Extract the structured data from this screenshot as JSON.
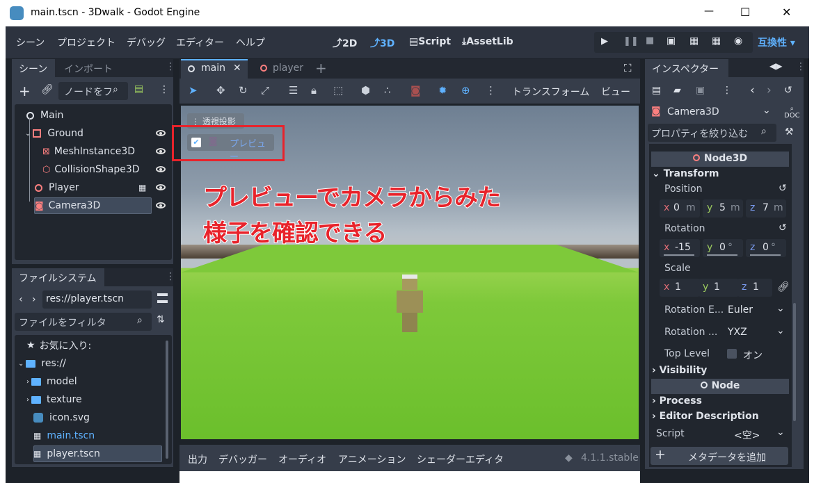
{
  "window": {
    "title": "main.tscn - 3Dwalk - Godot Engine",
    "minimize": "—",
    "maximize": "☐",
    "close": "✕"
  },
  "menu": {
    "items": [
      "シーン",
      "プロジェクト",
      "デバッグ",
      "エディター",
      "ヘルプ"
    ],
    "workspaces": [
      "2D",
      "3D",
      "Script",
      "AssetLib"
    ],
    "compat": "互換性"
  },
  "scene_dock": {
    "tabs": [
      "シーン",
      "インポート"
    ],
    "filter_placeholder": "ノードをフ",
    "nodes": [
      {
        "label": "Main"
      },
      {
        "label": "Ground"
      },
      {
        "label": "MeshInstance3D"
      },
      {
        "label": "CollisionShape3D"
      },
      {
        "label": "Player"
      },
      {
        "label": "Camera3D"
      }
    ]
  },
  "filesystem": {
    "tab": "ファイルシステム",
    "path": "res://player.tscn",
    "filter_placeholder": "ファイルをフィルタ",
    "items": [
      {
        "label": "お気に入り:"
      },
      {
        "label": "res://"
      },
      {
        "label": "model"
      },
      {
        "label": "texture"
      },
      {
        "label": "icon.svg"
      },
      {
        "label": "main.tscn"
      },
      {
        "label": "player.tscn"
      }
    ]
  },
  "editor": {
    "tabs": [
      "main",
      "player"
    ],
    "toolbar_menus": [
      "トランスフォーム",
      "ビュー"
    ],
    "perspective_label": "透視投影",
    "preview_label": "プレビュー",
    "annotation_line1": "プレビューでカメラからみた",
    "annotation_line2": "様子を確認できる",
    "bottom_tabs": [
      "出力",
      "デバッガー",
      "オーディオ",
      "アニメーション",
      "シェーダーエディタ"
    ],
    "version": "4.1.1.stable"
  },
  "inspector": {
    "tab": "インスペクター",
    "node_type": "Camera3D",
    "filter_placeholder": "プロパティを絞り込む",
    "section_node3d": "Node3D",
    "group_transform": "Transform",
    "position": {
      "label": "Position",
      "x": "0",
      "y": "5",
      "z": "7",
      "unit": "m"
    },
    "rotation": {
      "label": "Rotation",
      "x": "-15",
      "y": "0",
      "z": "0",
      "unit": "°"
    },
    "scale": {
      "label": "Scale",
      "x": "1",
      "y": "1",
      "z": "1"
    },
    "rotation_edit_mode": {
      "label": "Rotation E...",
      "value": "Euler"
    },
    "rotation_order": {
      "label": "Rotation ...",
      "value": "YXZ"
    },
    "top_level": {
      "label": "Top Level",
      "value": "オン"
    },
    "group_visibility": "Visibility",
    "section_node": "Node",
    "group_process": "Process",
    "group_editor_description": "Editor Description",
    "script": {
      "label": "Script",
      "value": "<空>"
    },
    "add_metadata": "メタデータを追加"
  },
  "colors": {
    "accent": "#5fb2ff",
    "annotation": "#e8232b",
    "sky_top": "#6e7f92",
    "grass": "#7ec93a"
  }
}
